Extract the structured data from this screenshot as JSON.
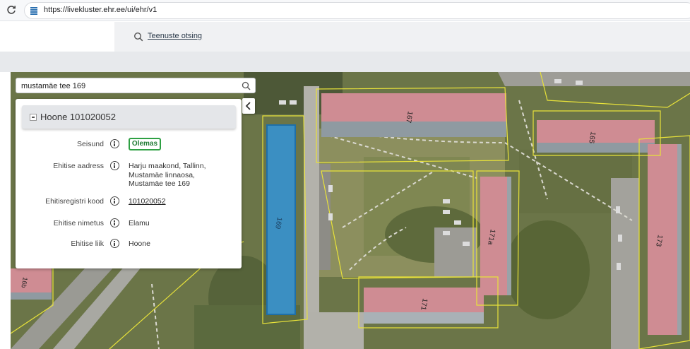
{
  "browser": {
    "url": "https://livekluster.ehr.ee/ui/ehr/v1"
  },
  "header": {
    "service_search_label": "Teenuste otsing"
  },
  "map": {
    "search_value": "mustamäe tee 169",
    "building_labels": [
      "169",
      "167",
      "165",
      "171a",
      "171",
      "173",
      "16b"
    ]
  },
  "panel": {
    "title": "Hoone 101020052",
    "rows": [
      {
        "label": "Seisund",
        "value": "Olemas"
      },
      {
        "label": "Ehitise aadress",
        "value_lines": [
          "Harju maakond, Tallinn,",
          "Mustamäe linnaosa,",
          "Mustamäe tee 169"
        ]
      },
      {
        "label": "Ehitisregistri kood",
        "value": "101020052"
      },
      {
        "label": "Ehitise nimetus",
        "value": "Elamu"
      },
      {
        "label": "Ehitise liik",
        "value": "Hoone"
      }
    ]
  },
  "colors": {
    "status_green": "#2ea043",
    "selected_building": "#3b8fc2",
    "roof": "#c98a8f",
    "parcel_lines": "#e8e23a"
  }
}
